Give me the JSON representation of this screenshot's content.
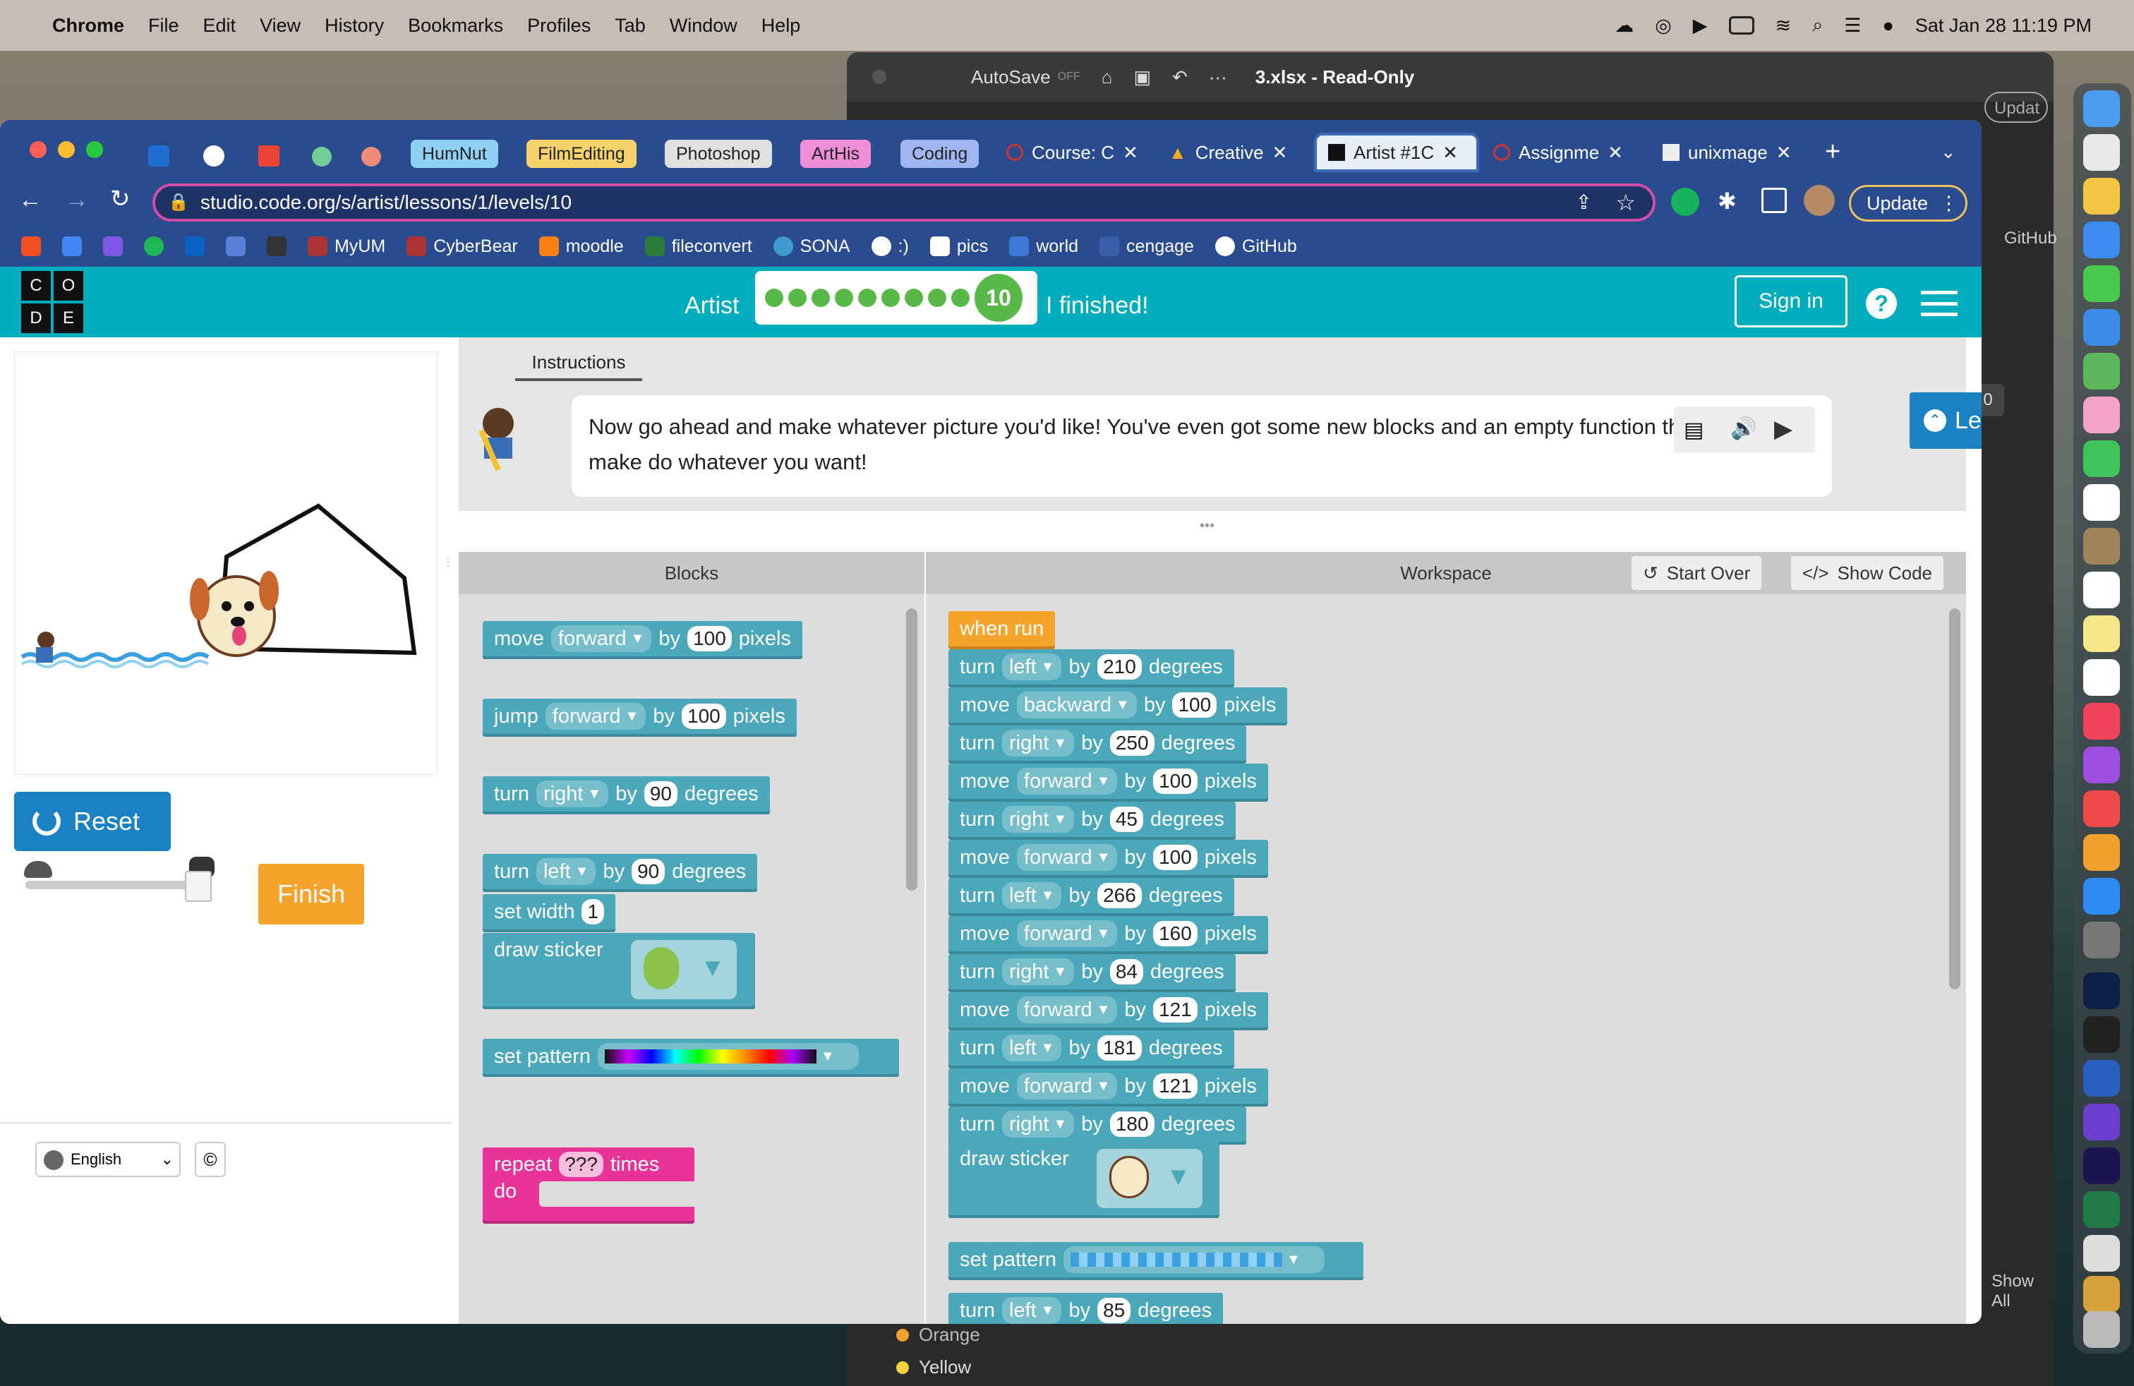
{
  "menubar": {
    "app": "Chrome",
    "items": [
      "File",
      "Edit",
      "View",
      "History",
      "Bookmarks",
      "Profiles",
      "Tab",
      "Window",
      "Help"
    ],
    "datetime": "Sat Jan 28  11:19 PM"
  },
  "excel": {
    "autosave": "AutoSave",
    "autosave_state": "OFF",
    "filename": "3.xlsx - Read-Only",
    "cell_value": "0",
    "update_label": "Updat",
    "github_label": "GitHub",
    "sheet_items": [
      "Orange",
      "Yellow"
    ],
    "show_all": "Show All"
  },
  "tab_groups": [
    "HumNut",
    "FilmEditing",
    "Photoshop",
    "ArtHis",
    "Coding"
  ],
  "tab_group_colors": [
    "#8fd1f5",
    "#f5d26a",
    "#e0e0e0",
    "#ee8ed9",
    "#9fb6f3"
  ],
  "tabs": [
    "Course: C",
    "Creative",
    "Artist #1C",
    "Assignme",
    "unixmage"
  ],
  "url": "studio.code.org/s/artist/lessons/1/levels/10",
  "update_label": "Update",
  "bookmarks": [
    "MyUM",
    "CyberBear",
    "moodle",
    "fileconvert",
    "SONA",
    ":)",
    "pics",
    "world",
    "cengage",
    "GitHub"
  ],
  "header": {
    "logo": [
      "C",
      "O",
      "D",
      "E"
    ],
    "artist": "Artist",
    "level": "10",
    "finished": "I finished!",
    "sign_in": "Sign in",
    "help": "?"
  },
  "left": {
    "reset": "Reset",
    "finish": "Finish",
    "language": "English",
    "copyright": "©"
  },
  "instructions": {
    "tab": "Instructions",
    "text": "Now go ahead and make whatever picture you'd like! You've even got some new blocks and an empty function that you can make do whatever you want!",
    "less": "Less"
  },
  "blocks_header": "Blocks",
  "workspace_header": "Workspace",
  "start_over": "Start Over",
  "show_code": "Show Code",
  "toolbox": [
    {
      "w1": "move",
      "dd": "forward",
      "w2": "by",
      "val": "100",
      "w3": "pixels"
    },
    {
      "w1": "jump",
      "dd": "forward",
      "w2": "by",
      "val": "100",
      "w3": "pixels"
    },
    {
      "w1": "turn",
      "dd": "right",
      "w2": "by",
      "val": "90",
      "w3": "degrees"
    },
    {
      "w1": "turn",
      "dd": "left",
      "w2": "by",
      "val": "90",
      "w3": "degrees"
    }
  ],
  "toolbox_extra": {
    "set_width": "set width",
    "width_val": "1",
    "draw_sticker": "draw sticker",
    "set_pattern": "set pattern",
    "repeat": "repeat",
    "repeat_val": "???",
    "times": "times",
    "do": "do"
  },
  "program_start": "when run",
  "program": [
    {
      "w1": "turn",
      "dd": "left",
      "w2": "by",
      "val": "210",
      "w3": "degrees"
    },
    {
      "w1": "move",
      "dd": "backward",
      "w2": "by",
      "val": "100",
      "w3": "pixels"
    },
    {
      "w1": "turn",
      "dd": "right",
      "w2": "by",
      "val": "250",
      "w3": "degrees"
    },
    {
      "w1": "move",
      "dd": "forward",
      "w2": "by",
      "val": "100",
      "w3": "pixels"
    },
    {
      "w1": "turn",
      "dd": "right",
      "w2": "by",
      "val": "45",
      "w3": "degrees"
    },
    {
      "w1": "move",
      "dd": "forward",
      "w2": "by",
      "val": "100",
      "w3": "pixels"
    },
    {
      "w1": "turn",
      "dd": "left",
      "w2": "by",
      "val": "266",
      "w3": "degrees"
    },
    {
      "w1": "move",
      "dd": "forward",
      "w2": "by",
      "val": "160",
      "w3": "pixels"
    },
    {
      "w1": "turn",
      "dd": "right",
      "w2": "by",
      "val": "84",
      "w3": "degrees"
    },
    {
      "w1": "move",
      "dd": "forward",
      "w2": "by",
      "val": "121",
      "w3": "pixels"
    },
    {
      "w1": "turn",
      "dd": "left",
      "w2": "by",
      "val": "181",
      "w3": "degrees"
    },
    {
      "w1": "move",
      "dd": "forward",
      "w2": "by",
      "val": "121",
      "w3": "pixels"
    },
    {
      "w1": "turn",
      "dd": "right",
      "w2": "by",
      "val": "180",
      "w3": "degrees"
    }
  ],
  "program_extra": {
    "draw_sticker": "draw sticker",
    "set_pattern": "set pattern",
    "last": {
      "w1": "turn",
      "dd": "left",
      "w2": "by",
      "val": "85",
      "w3": "degrees"
    }
  },
  "colors": {
    "chrome_tabbar": "#2a4c8f",
    "codeorg_teal": "#00adbc",
    "block_teal": "#4aa8ba",
    "orange": "#f6a32c",
    "pink": "#e9339b",
    "blue": "#1a82c4",
    "progress_green": "#59b948"
  }
}
